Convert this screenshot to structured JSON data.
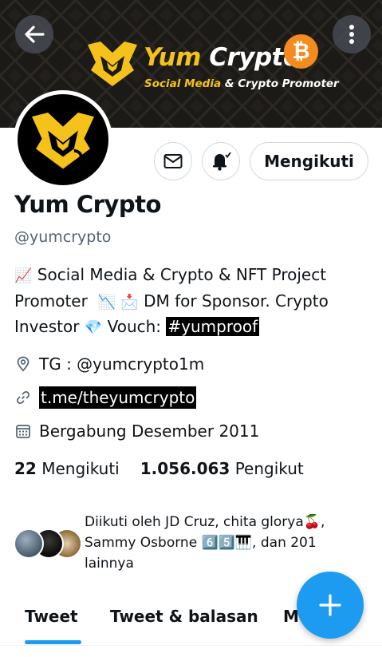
{
  "banner": {
    "title_part1": "Yum",
    "title_part2": "Crypto",
    "subtitle_part1": "Social Media",
    "subtitle_part2": "& Crypto Promoter",
    "badge_symbol": "₿"
  },
  "profile": {
    "display_name": "Yum Crypto",
    "handle": "@yumcrypto",
    "bio_line1_text": "Social Media & Crypto & NFT Project",
    "bio_line2_text1": "Promoter",
    "bio_line2_text2": "DM for Sponsor. Crypto",
    "bio_line3_text1": "Investor",
    "bio_line3_text2": "Vouch:",
    "hashtag": "#yumproof",
    "emoji_chart_up": "📈",
    "emoji_chart_down": "📉",
    "emoji_inbox": "📩",
    "emoji_diamond": "💎",
    "location": "TG : @yumcrypto1m",
    "link": "t.me/theyumcrypto",
    "joined": "Bergabung Desember 2011"
  },
  "actions": {
    "follow_label": "Mengikuti"
  },
  "stats": {
    "following_count": "22",
    "following_label": "Mengikuti",
    "followers_count": "1.056.063",
    "followers_label": "Pengikut"
  },
  "followed_by": {
    "line1": "Diikuti oleh JD Cruz, chita glorya🍒,",
    "line2": "Sammy Osborne 6️⃣5️⃣🎹, dan 201",
    "line3": "lainnya"
  },
  "tabs": [
    {
      "label": "Tweet"
    },
    {
      "label": "Tweet & balasan"
    },
    {
      "label": "M"
    }
  ],
  "colors": {
    "accent": "#1d9bf0",
    "brand_yellow": "#f4c21b",
    "bitcoin_orange": "#f58a1f"
  },
  "icons": {
    "back": "arrow-left-icon",
    "more": "more-vertical-icon",
    "mail": "mail-icon",
    "bell": "bell-check-icon",
    "location": "location-pin-icon",
    "link": "link-icon",
    "calendar": "calendar-icon",
    "compose": "plus-icon"
  }
}
